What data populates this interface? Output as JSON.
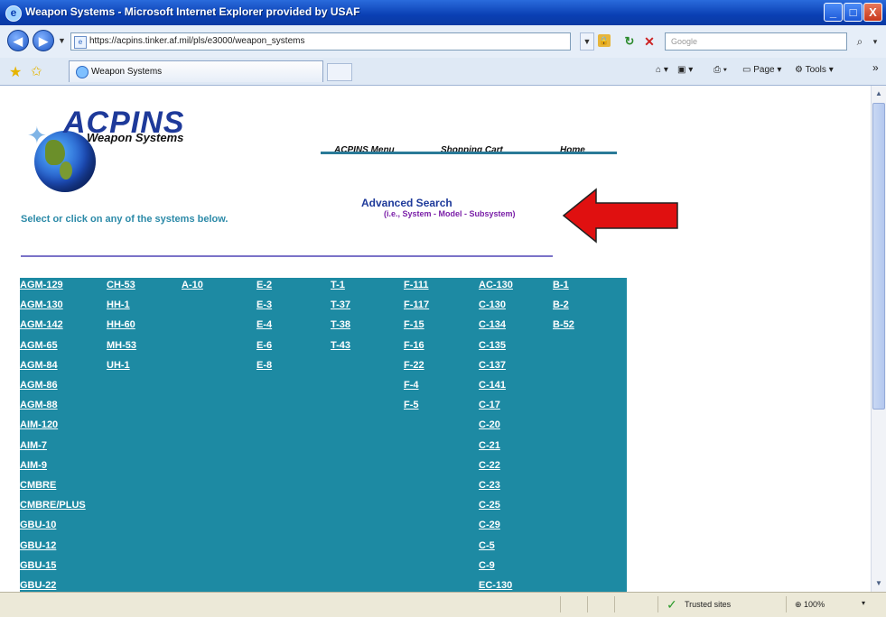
{
  "window": {
    "title": "Weapon Systems - Microsoft Internet Explorer provided by USAF",
    "min": "_",
    "max": "□",
    "close": "X"
  },
  "addressbar": {
    "url": "https://acpins.tinker.af.mil/pls/e3000/weapon_systems",
    "search_placeholder": "Google"
  },
  "tabs": {
    "active_label": "Weapon Systems"
  },
  "commandbar": {
    "page": "Page",
    "tools": "Tools",
    "more": "»"
  },
  "page": {
    "logo_title": "ACPINS",
    "logo_subtitle": "Weapon Systems",
    "menu": [
      "ACPINS Menu",
      "Shopping Cart",
      "Home"
    ],
    "advanced_search": "Advanced Search",
    "advanced_search_hint": "(i.e., System - Model - Subsystem)",
    "instruction": "Select or click on any of the systems below.",
    "systems": [
      [
        "AGM-129",
        "AGM-130",
        "AGM-142",
        "AGM-65",
        "AGM-84",
        "AGM-86",
        "AGM-88",
        "AIM-120",
        "AIM-7",
        "AIM-9",
        "CMBRE",
        "CMBRE/PLUS",
        "GBU-10",
        "GBU-12",
        "GBU-15",
        "GBU-22"
      ],
      [
        "CH-53",
        "HH-1",
        "HH-60",
        "MH-53",
        "UH-1"
      ],
      [
        "A-10"
      ],
      [
        "E-2",
        "E-3",
        "E-4",
        "E-6",
        "E-8"
      ],
      [
        "T-1",
        "T-37",
        "T-38",
        "T-43"
      ],
      [
        "F-111",
        "F-117",
        "F-15",
        "F-16",
        "F-22",
        "F-4",
        "F-5"
      ],
      [
        "AC-130",
        "C-130",
        "C-134",
        "C-135",
        "C-137",
        "C-141",
        "C-17",
        "C-20",
        "C-21",
        "C-22",
        "C-23",
        "C-25",
        "C-29",
        "C-5",
        "C-9",
        "EC-130"
      ],
      [
        "B-1",
        "B-2",
        "B-52"
      ]
    ]
  },
  "statusbar": {
    "zone": "Trusted sites",
    "zoom": "100%"
  },
  "colors": {
    "table_bg": "#1d8aa3",
    "arrow": "#e01010",
    "link": "#ffffff"
  }
}
